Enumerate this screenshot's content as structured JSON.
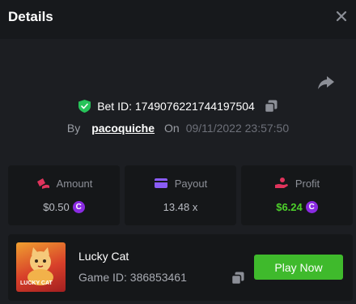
{
  "header": {
    "title": "Details",
    "close_icon": "close-icon"
  },
  "share_icon": "share-arrow-icon",
  "bet": {
    "id_text": "Bet ID: 1749076221744197504",
    "by_label": "By",
    "username": "pacoquiche",
    "on_label": "On",
    "datetime": "09/11/2022 23:57:50"
  },
  "stats": {
    "amount": {
      "label": "Amount",
      "value": "$0.50",
      "icon": "coins-icon"
    },
    "payout": {
      "label": "Payout",
      "value": "13.48 x",
      "icon": "card-icon"
    },
    "profit": {
      "label": "Profit",
      "value": "$6.24",
      "icon": "hand-coin-icon"
    }
  },
  "currency_icon": "C",
  "game": {
    "name": "Lucky Cat",
    "id_text": "Game ID: 386853461",
    "thumb_text": "LUCKY CAT",
    "play_label": "Play Now"
  },
  "colors": {
    "background": "#1c1e22",
    "header": "#17191c",
    "card": "#151719",
    "accent_green": "#3fba2c",
    "profit_green": "#4dd12b",
    "coin_purple": "#8a2be2",
    "shield_green": "#27c35a"
  }
}
